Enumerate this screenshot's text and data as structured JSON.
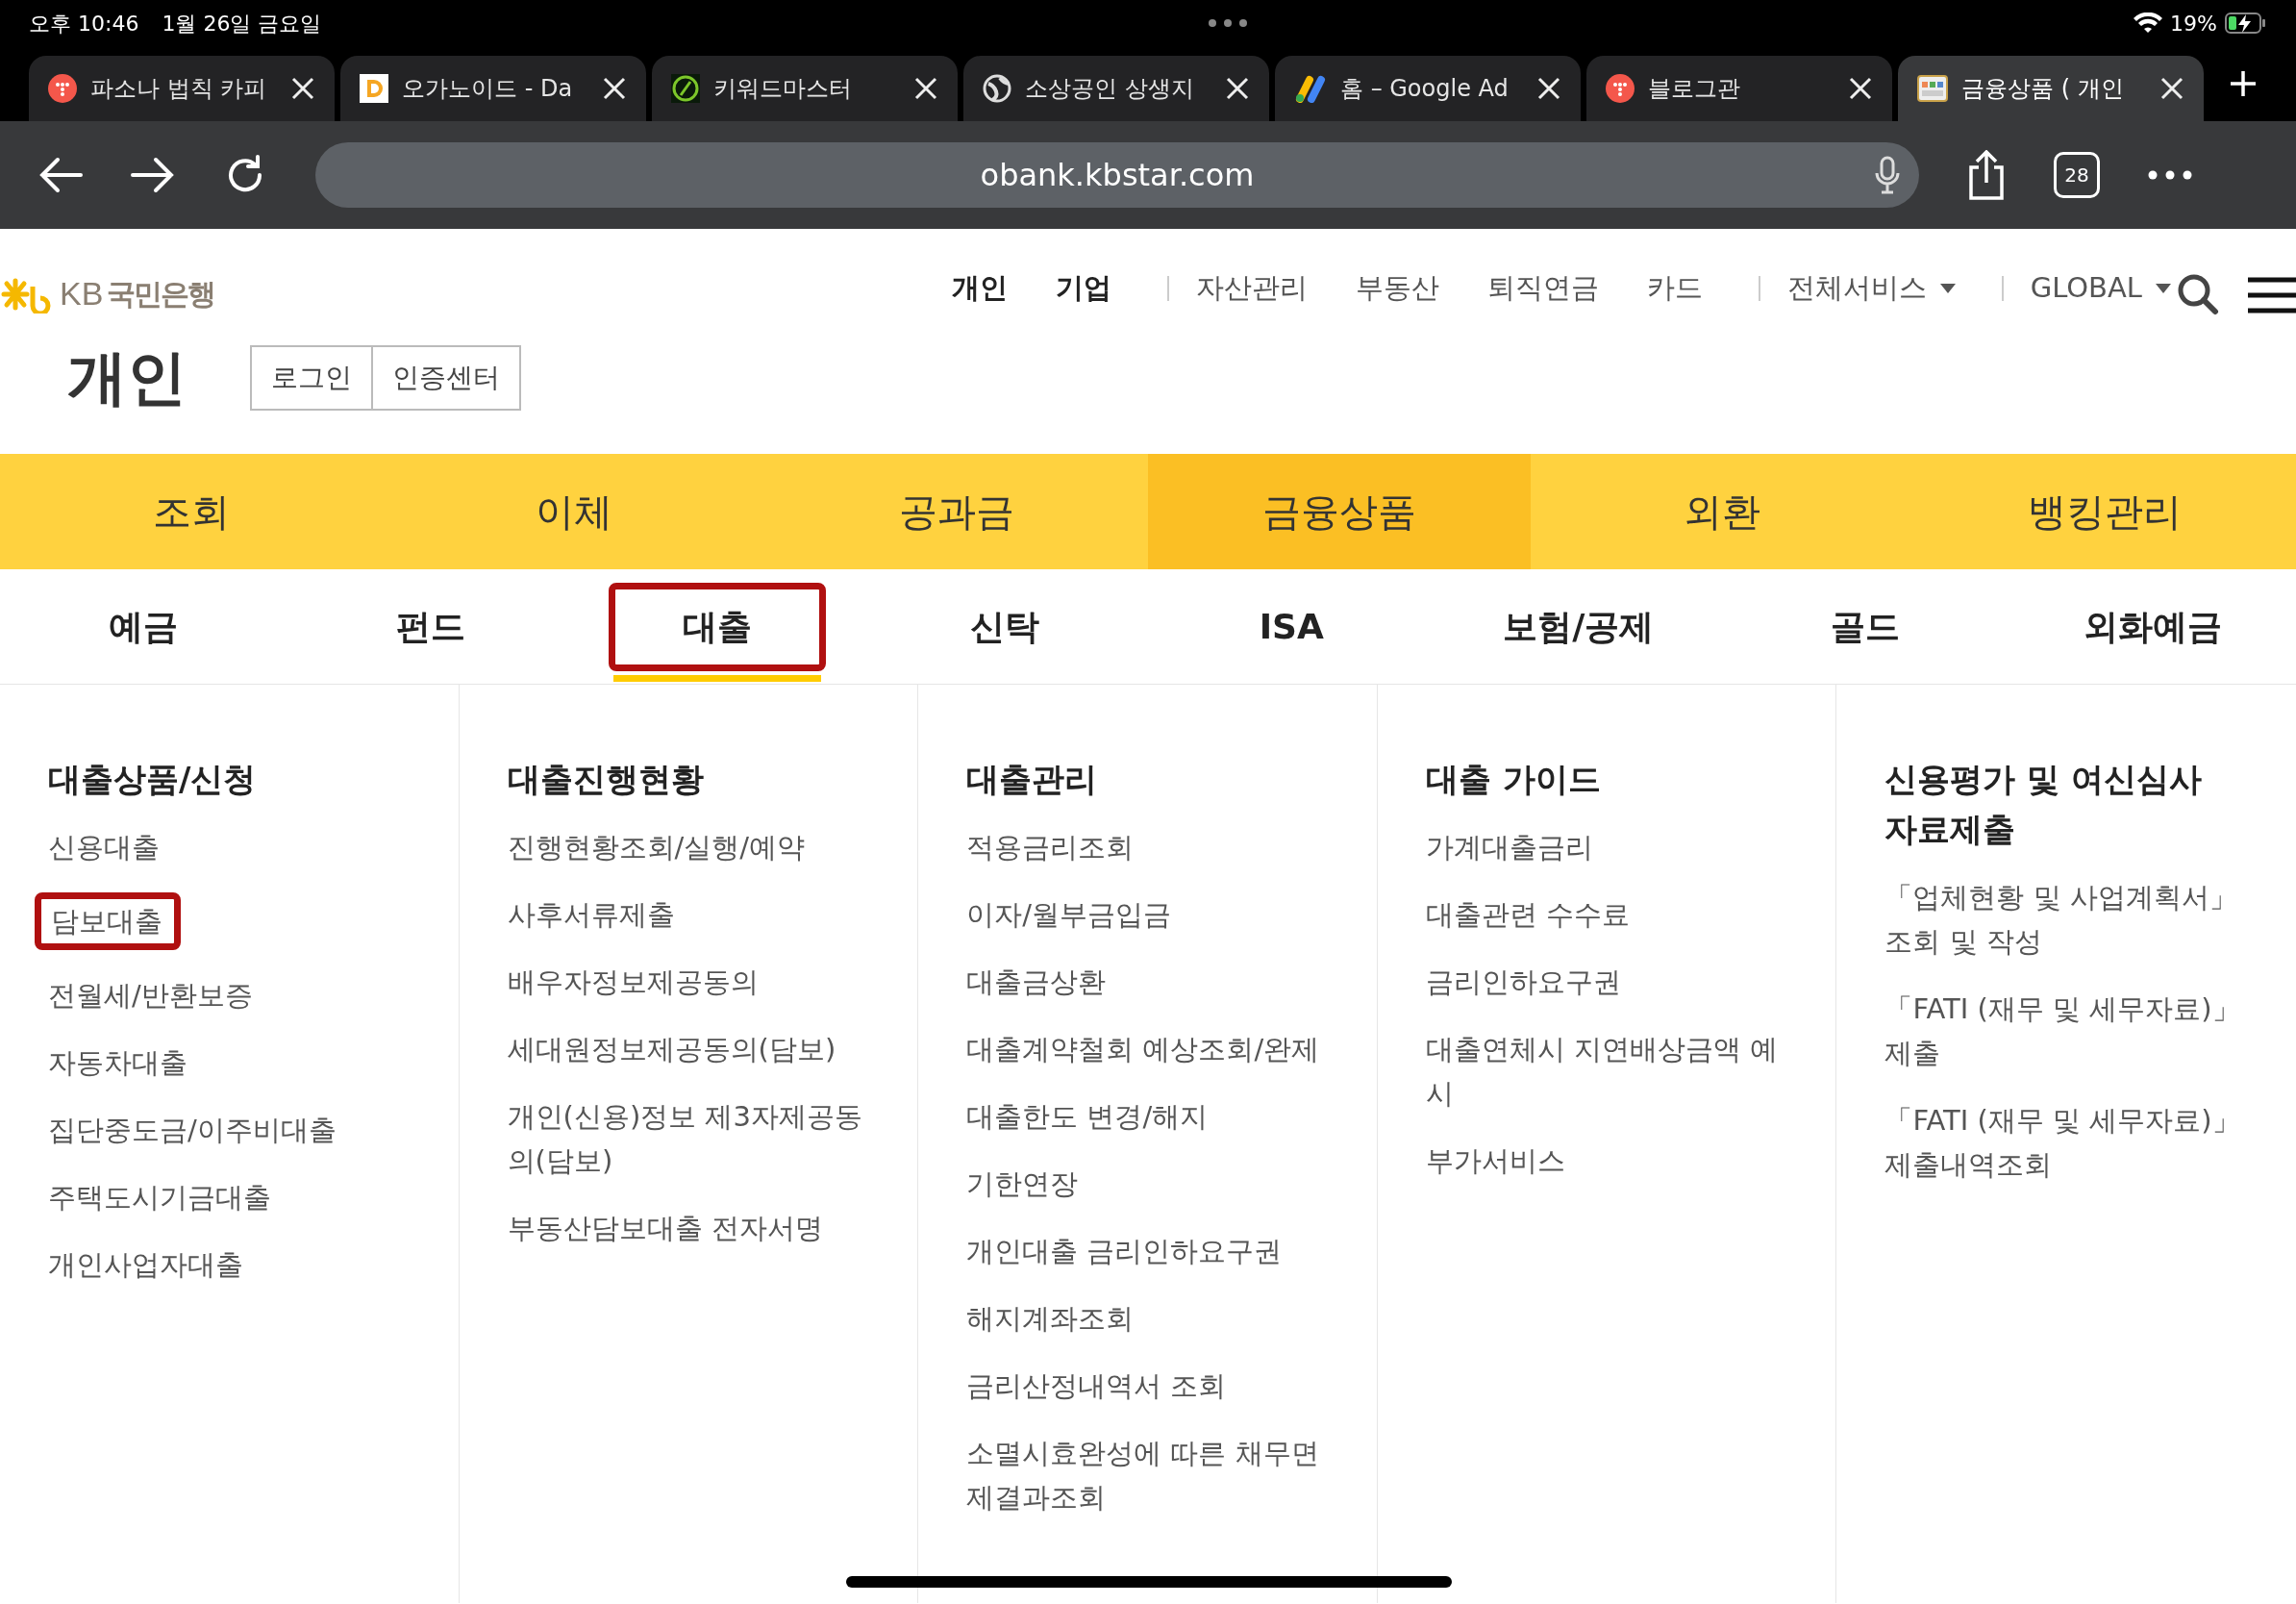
{
  "status_bar": {
    "time": "오후 10:46",
    "date": "1월 26일 금요일",
    "battery": "19%"
  },
  "browser_tabs": [
    {
      "title": "파소나 법칙 카피",
      "selected": false
    },
    {
      "title": "오가노이드 - Da",
      "selected": false
    },
    {
      "title": "키워드마스터",
      "selected": false
    },
    {
      "title": "소상공인 상생지",
      "selected": false
    },
    {
      "title": "홈 – Google Ad",
      "selected": false
    },
    {
      "title": "블로그관",
      "selected": false
    },
    {
      "title": "금융상품 ( 개인",
      "selected": true
    }
  ],
  "toolbar": {
    "url": "obank.kbstar.com",
    "tab_count": "28"
  },
  "site_header": {
    "logo": {
      "mark": "KB",
      "name": "국민은행"
    },
    "top_nav": [
      {
        "label": "개인",
        "kind": "primary",
        "separator_before": false
      },
      {
        "label": "기업",
        "kind": "primary",
        "separator_before": false
      },
      {
        "label": "자산관리",
        "kind": "link",
        "separator_before": true
      },
      {
        "label": "부동산",
        "kind": "link",
        "separator_before": false
      },
      {
        "label": "퇴직연금",
        "kind": "link",
        "separator_before": false
      },
      {
        "label": "카드",
        "kind": "link",
        "separator_before": false
      },
      {
        "label": "전체서비스",
        "kind": "dropdown",
        "separator_before": true
      },
      {
        "label": "GLOBAL",
        "kind": "dropdown",
        "separator_before": true
      }
    ],
    "page_title": "개인",
    "buttons": [
      "로그인",
      "인증센터"
    ]
  },
  "main_nav": [
    {
      "label": "조회",
      "selected": false
    },
    {
      "label": "이체",
      "selected": false
    },
    {
      "label": "공과금",
      "selected": false
    },
    {
      "label": "금융상품",
      "selected": true
    },
    {
      "label": "외환",
      "selected": false
    },
    {
      "label": "뱅킹관리",
      "selected": false
    }
  ],
  "sub_nav": [
    {
      "label": "예금",
      "selected": false,
      "highlighted": false
    },
    {
      "label": "펀드",
      "selected": false,
      "highlighted": false
    },
    {
      "label": "대출",
      "selected": true,
      "highlighted": true
    },
    {
      "label": "신탁",
      "selected": false,
      "highlighted": false
    },
    {
      "label": "ISA",
      "selected": false,
      "highlighted": false
    },
    {
      "label": "보험/공제",
      "selected": false,
      "highlighted": false
    },
    {
      "label": "골드",
      "selected": false,
      "highlighted": false
    },
    {
      "label": "외화예금",
      "selected": false,
      "highlighted": false
    }
  ],
  "menu_columns": [
    {
      "heading": "대출상품/신청",
      "items": [
        {
          "label": "신용대출",
          "highlighted": false
        },
        {
          "label": "담보대출",
          "highlighted": true
        },
        {
          "label": "전월세/반환보증",
          "highlighted": false
        },
        {
          "label": "자동차대출",
          "highlighted": false
        },
        {
          "label": "집단중도금/이주비대출",
          "highlighted": false
        },
        {
          "label": "주택도시기금대출",
          "highlighted": false
        },
        {
          "label": "개인사업자대출",
          "highlighted": false
        }
      ]
    },
    {
      "heading": "대출진행현황",
      "items": [
        {
          "label": "진행현황조회/실행/예약",
          "highlighted": false
        },
        {
          "label": "사후서류제출",
          "highlighted": false
        },
        {
          "label": "배우자정보제공동의",
          "highlighted": false
        },
        {
          "label": "세대원정보제공동의(담보)",
          "highlighted": false
        },
        {
          "label": "개인(신용)정보 제3자제공동의(담보)",
          "highlighted": false
        },
        {
          "label": "부동산담보대출 전자서명",
          "highlighted": false
        }
      ]
    },
    {
      "heading": "대출관리",
      "items": [
        {
          "label": "적용금리조회",
          "highlighted": false
        },
        {
          "label": "이자/월부금입금",
          "highlighted": false
        },
        {
          "label": "대출금상환",
          "highlighted": false
        },
        {
          "label": "대출계약철회 예상조회/완제",
          "highlighted": false
        },
        {
          "label": "대출한도 변경/해지",
          "highlighted": false
        },
        {
          "label": "기한연장",
          "highlighted": false
        },
        {
          "label": "개인대출 금리인하요구권",
          "highlighted": false
        },
        {
          "label": "해지계좌조회",
          "highlighted": false
        },
        {
          "label": "금리산정내역서 조회",
          "highlighted": false
        },
        {
          "label": "소멸시효완성에 따른 채무면제결과조회",
          "highlighted": false
        }
      ]
    },
    {
      "heading": "대출 가이드",
      "items": [
        {
          "label": "가계대출금리",
          "highlighted": false
        },
        {
          "label": "대출관련 수수료",
          "highlighted": false
        },
        {
          "label": "금리인하요구권",
          "highlighted": false
        },
        {
          "label": "대출연체시 지연배상금액 예시",
          "highlighted": false
        },
        {
          "label": "부가서비스",
          "highlighted": false
        }
      ]
    },
    {
      "heading": "신용평가 및 여신심사 자료제출",
      "items": [
        {
          "label": "「업체현황 및 사업계획서」조회 및 작성",
          "highlighted": false
        },
        {
          "label": "「FATI (재무 및 세무자료)」 제출",
          "highlighted": false
        },
        {
          "label": "「FATI (재무 및 세무자료)」 제출내역조회",
          "highlighted": false
        }
      ]
    }
  ]
}
